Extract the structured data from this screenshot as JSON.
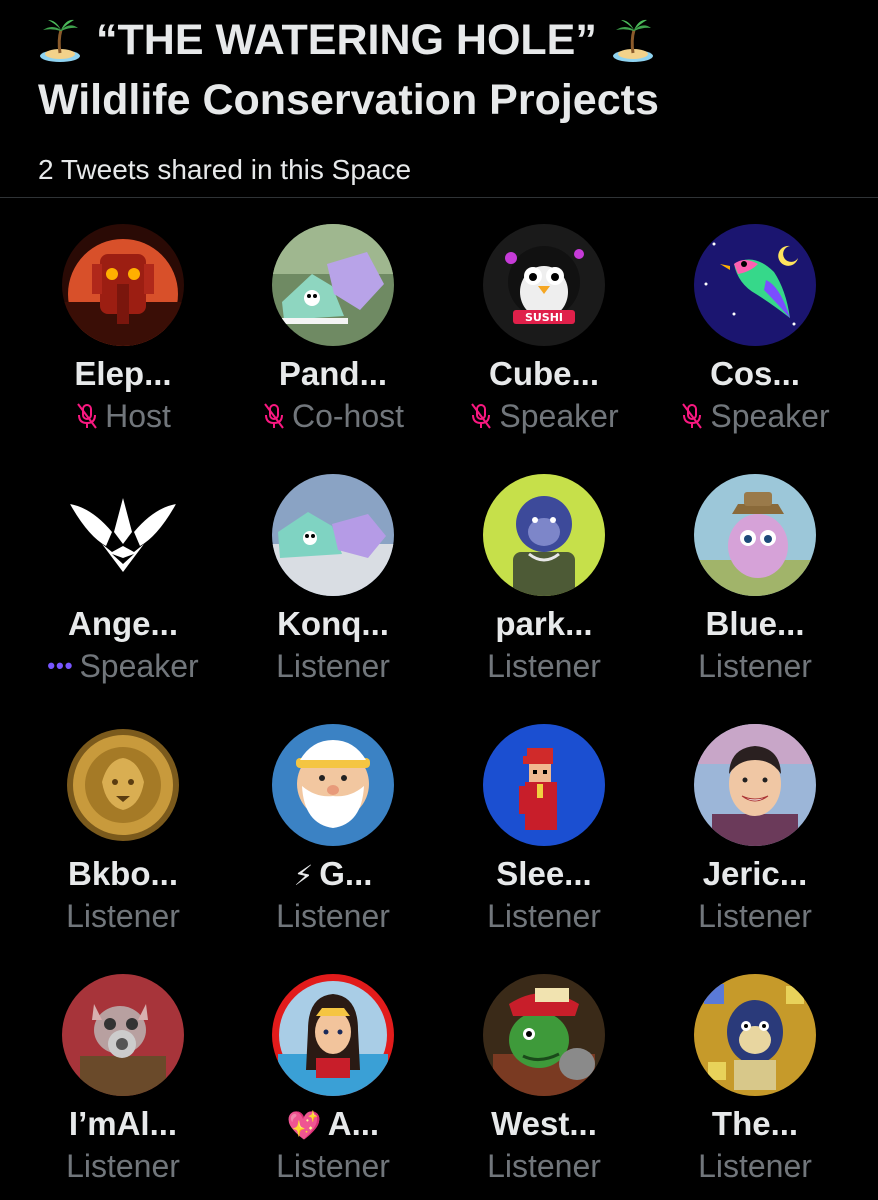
{
  "header": {
    "title_line1": "“THE WATERING HOLE”",
    "title_line2": "Wildlife Conservation Projects",
    "title_icon": "desert-island-icon",
    "shared_text": "2 Tweets shared in this Space"
  },
  "participants": [
    {
      "name": "Elep...",
      "role": "Host",
      "muted": true,
      "speaking": false,
      "avatar": "red-robot-elephant",
      "name_prefix": ""
    },
    {
      "name": "Pand...",
      "role": "Co-host",
      "muted": true,
      "speaking": false,
      "avatar": "panda-sneakers",
      "name_prefix": ""
    },
    {
      "name": "Cube...",
      "role": "Speaker",
      "muted": true,
      "speaking": false,
      "avatar": "penguin-sushi",
      "name_prefix": ""
    },
    {
      "name": "Cos...",
      "role": "Speaker",
      "muted": true,
      "speaking": false,
      "avatar": "neon-bird-night",
      "name_prefix": ""
    },
    {
      "name": "Ange...",
      "role": "Speaker",
      "muted": false,
      "speaking": true,
      "avatar": "white-winged-emblem",
      "name_prefix": ""
    },
    {
      "name": "Konq...",
      "role": "Listener",
      "muted": false,
      "speaking": false,
      "avatar": "panda-sneakers-sky",
      "name_prefix": ""
    },
    {
      "name": "park...",
      "role": "Listener",
      "muted": false,
      "speaking": false,
      "avatar": "blue-ape",
      "name_prefix": ""
    },
    {
      "name": "Blue...",
      "role": "Listener",
      "muted": false,
      "speaking": false,
      "avatar": "fuzzy-creature",
      "name_prefix": ""
    },
    {
      "name": "Bkbo...",
      "role": "Listener",
      "muted": false,
      "speaking": false,
      "avatar": "gold-lion-coin",
      "name_prefix": ""
    },
    {
      "name": "G...",
      "role": "Listener",
      "muted": false,
      "speaking": false,
      "avatar": "bearded-man-headband",
      "name_prefix": "⚡"
    },
    {
      "name": "Slee...",
      "role": "Listener",
      "muted": false,
      "speaking": false,
      "avatar": "pixel-figure-blue",
      "name_prefix": ""
    },
    {
      "name": "Jeric...",
      "role": "Listener",
      "muted": false,
      "speaking": false,
      "avatar": "smiling-man-portrait",
      "name_prefix": ""
    },
    {
      "name": "I’mAl...",
      "role": "Listener",
      "muted": false,
      "speaking": false,
      "avatar": "rat-gas-mask",
      "name_prefix": ""
    },
    {
      "name": "A...",
      "role": "Listener",
      "muted": false,
      "speaking": false,
      "avatar": "wonder-woman-cartoon",
      "name_prefix": "💖"
    },
    {
      "name": "West...",
      "role": "Listener",
      "muted": false,
      "speaking": false,
      "avatar": "green-lizard-cap",
      "name_prefix": ""
    },
    {
      "name": "The...",
      "role": "Listener",
      "muted": false,
      "speaking": false,
      "avatar": "golden-ape-pattern",
      "name_prefix": ""
    }
  ],
  "colors": {
    "background": "#000000",
    "text_primary": "#e7e9ea",
    "text_secondary": "#71767b",
    "muted_mic": "#f91880",
    "speaking_dots": "#7856ff"
  }
}
